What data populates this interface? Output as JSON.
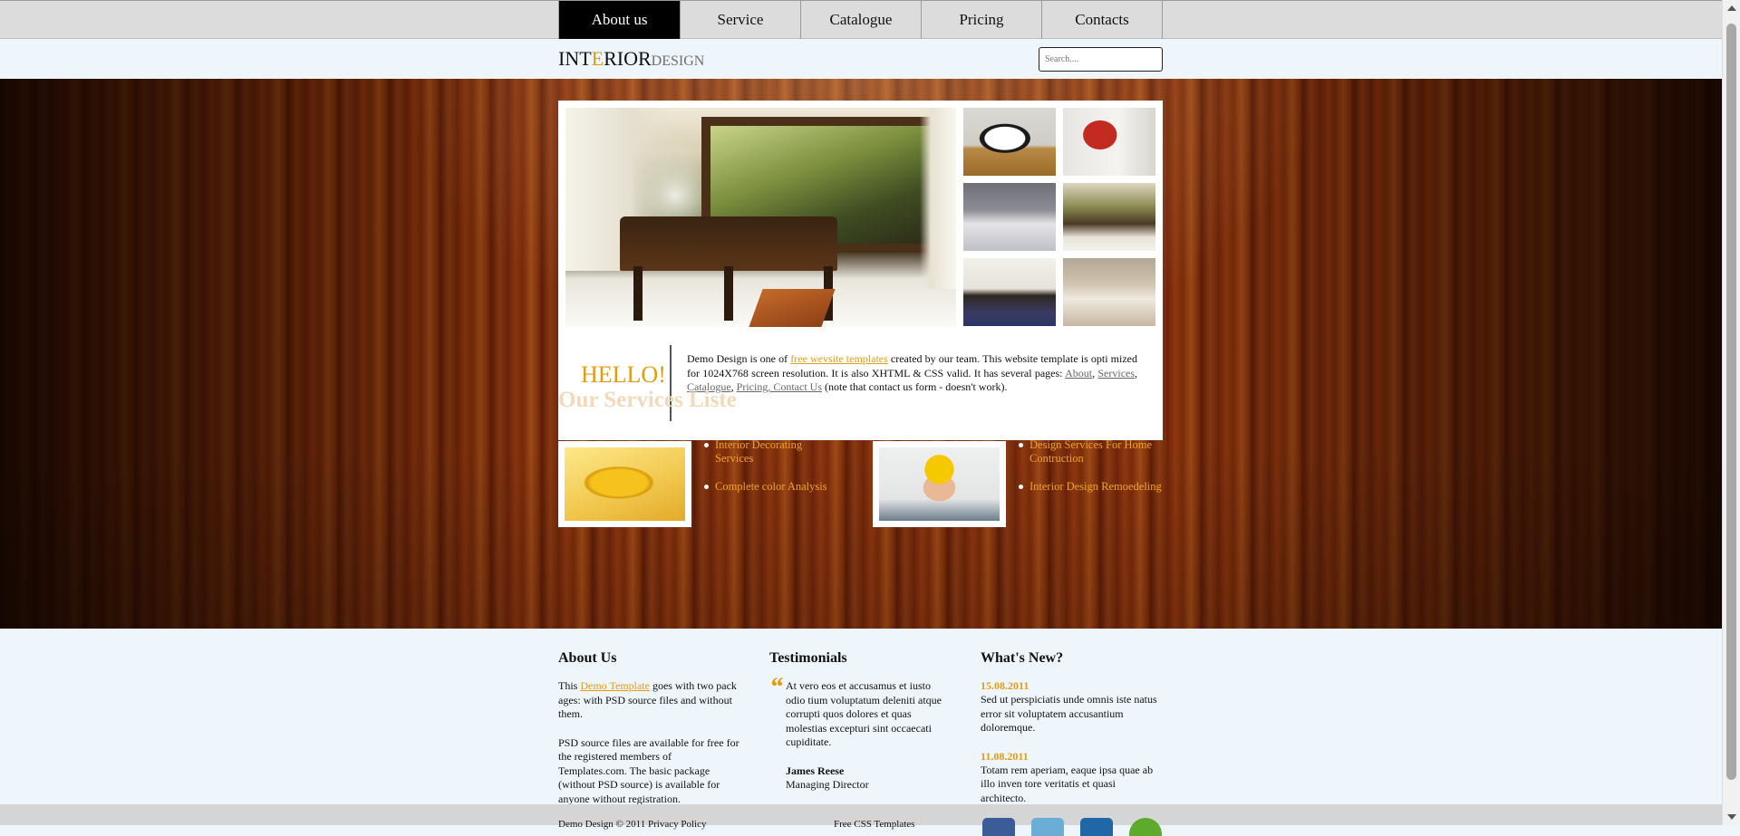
{
  "nav": {
    "tabs": [
      {
        "label": "About us",
        "active": true
      },
      {
        "label": "Service",
        "active": false
      },
      {
        "label": "Catalogue",
        "active": false
      },
      {
        "label": "Pricing",
        "active": false
      },
      {
        "label": "Contacts",
        "active": false
      }
    ]
  },
  "header": {
    "logo_part1": "INT",
    "logo_part2": "E",
    "logo_part3": "RIOR",
    "logo_part4": "DESIGN",
    "search_placeholder": "Search...."
  },
  "hero": {
    "hello": "HELLO!",
    "intro_text_1": "Demo Design is one of ",
    "intro_link": "free wevsite templates",
    "intro_text_2": " created by our team. This website template is opti mized for 1024X768 screen resolution. It is also XHTML & CSS valid. It has several pages: ",
    "page_links": [
      "About",
      "Services",
      "Catalogue",
      "Pricing",
      "Contact Us"
    ],
    "intro_text_3": " (note that contact us form - doesn't work)."
  },
  "services": {
    "title": "Our Services Liste",
    "list_1": [
      "Interior Decorating Services",
      "Complete color Analysis"
    ],
    "list_2": [
      "Design Services For Home Contruction",
      "Interior Design Remoedeling"
    ]
  },
  "footer": {
    "about": {
      "title": "About Us",
      "p1_before": "This ",
      "p1_link": "Demo Template",
      "p1_after": " goes with two pack ages: with PSD source files and without them.",
      "p2": "PSD source files are available for free for the registered members of Templates.com. The basic package (without PSD source) is available for anyone without registration."
    },
    "testimonials": {
      "title": "Testimonials",
      "quote": "At vero eos et accusamus et iusto odio tium voluptatum deleniti atque corrupti quos dolores et quas molestias excepturi sint occaecati cupiditate.",
      "author": "James Reese",
      "role": "Managing Director"
    },
    "news": {
      "title": "What's New?",
      "items": [
        {
          "date": "15.08.2011",
          "text": "Sed ut perspiciatis unde omnis iste natus error sit voluptatem accusantium doloremque."
        },
        {
          "date": "11.08.2011",
          "text": "Totam rem aperiam, eaque ipsa quae ab illo inven tore veritatis et quasi architecto."
        }
      ]
    }
  },
  "bottom": {
    "copyright": "Demo Design © 2011 Privacy Policy",
    "links": "Free CSS Templates"
  },
  "colors": {
    "accent": "#e39b12",
    "nav_active_bg": "#000000",
    "page_bg": "#eef6fc"
  },
  "icons": [
    "facebook-icon",
    "twitter-icon",
    "linkedin-icon",
    "rss-icon"
  ]
}
